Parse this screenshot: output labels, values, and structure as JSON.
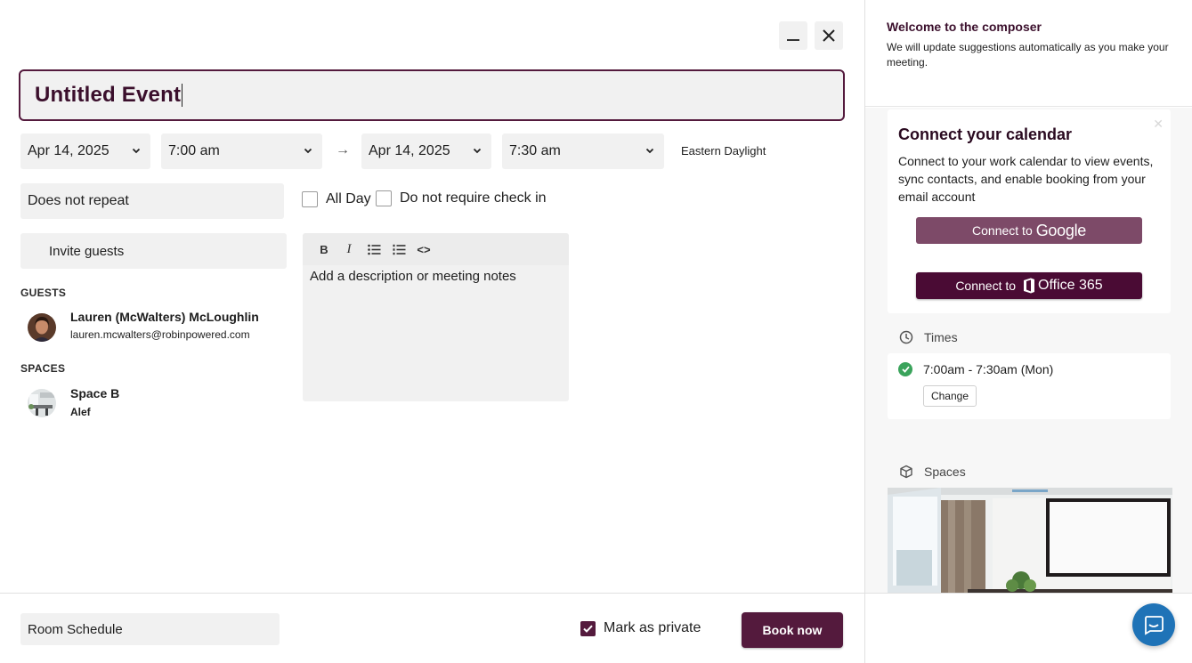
{
  "composer": {
    "title": "Untitled Event",
    "start_date": "Apr 14, 2025",
    "start_time": "7:00 am",
    "arrow": "→",
    "end_date": "Apr 14, 2025",
    "end_time": "7:30 am",
    "timezone": "Eastern Daylight",
    "repeat": "Does not repeat",
    "all_day_label": "All Day",
    "no_checkin_label": "Do not require check in",
    "invite_placeholder": "Invite guests",
    "guests_label": "GUESTS",
    "guests": [
      {
        "name": "Lauren (McWalters) McLoughlin",
        "email": "lauren.mcwalters@robinpowered.com"
      }
    ],
    "spaces_label": "SPACES",
    "spaces": [
      {
        "name": "Space B",
        "floor": "Alef"
      }
    ],
    "editor": {
      "bold": "B",
      "italic": "I",
      "code": "<>",
      "placeholder": "Add a description or meeting notes"
    }
  },
  "footer": {
    "room_schedule": "Room Schedule",
    "mark_private_label": "Mark as private",
    "mark_private_checked": true,
    "book_now": "Book now"
  },
  "panel": {
    "welcome_title": "Welcome to the composer",
    "welcome_sub": "We will update suggestions automatically as you make your meeting.",
    "connect_title": "Connect your calendar",
    "connect_desc": "Connect to your work calendar to view events, sync contacts, and enable booking from your email account",
    "connect_google_prefix": "Connect to",
    "connect_google_brand": "Google",
    "connect_office_prefix": "Connect to",
    "connect_office_brand": "Office 365",
    "times_label": "Times",
    "time_slot": "7:00am - 7:30am (Mon)",
    "change_label": "Change",
    "spaces_label": "Spaces"
  },
  "colors": {
    "brand": "#541a3d",
    "brand_light": "#7d4a68",
    "success": "#3aa35b",
    "chat": "#1f73b7"
  }
}
